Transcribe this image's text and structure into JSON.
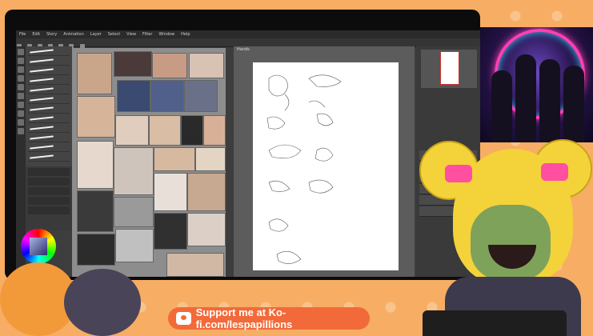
{
  "menu": [
    "File",
    "Edit",
    "Story",
    "Animation",
    "Layer",
    "Select",
    "View",
    "Filter",
    "Window",
    "Help"
  ],
  "canvas_tab": "Hands",
  "banner": {
    "text": "Support me at Ko-fi.com/lespapillions"
  },
  "colors": {
    "background": "#f7ad64",
    "banner": "#f26a3a",
    "ui": "#3d3d3d"
  }
}
